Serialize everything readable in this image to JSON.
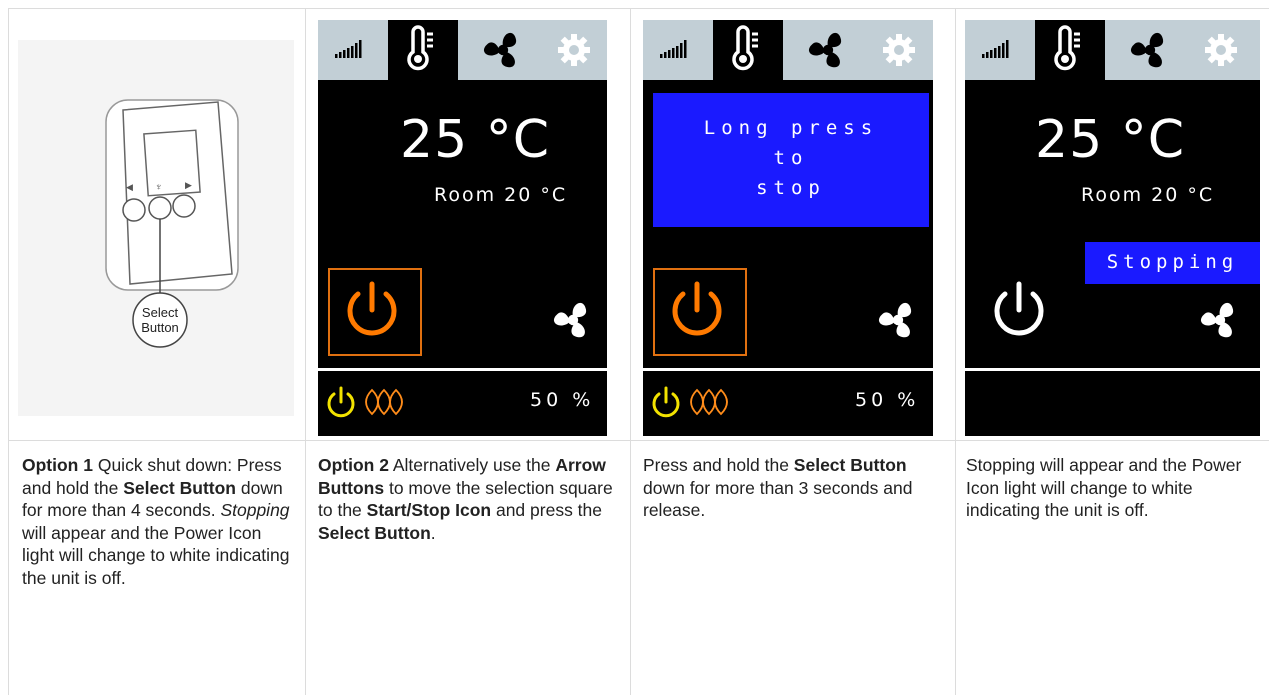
{
  "device": {
    "select_label_line1": "Select",
    "select_label_line2": "Button"
  },
  "screens": [
    {
      "temp": "25 °C",
      "room": "Room 20 °C",
      "percent": "50 %"
    },
    {
      "message_lines": [
        "Long press",
        "to",
        "stop"
      ],
      "percent": "50 %"
    },
    {
      "temp": "25 °C",
      "room": "Room 20 °C",
      "status": "Stopping"
    }
  ],
  "captions": [
    {
      "b1": "Option 1",
      "t1": " Quick shut down: Press and hold the ",
      "b2": "Select Button",
      "t2": " down for more than 4 seconds. ",
      "i1": "Stopping",
      "t3": " will appear and the Power Icon light will change to white indicating the unit is off."
    },
    {
      "b1": "Option 2",
      "t1": " Alternatively use the ",
      "b2": "Arrow Buttons",
      "t2": " to move the selection square to the ",
      "b3": "Start/Stop Icon",
      "t3": " and press the ",
      "b4": "Select Button",
      "t4": "."
    },
    {
      "t1": "Press and hold the ",
      "b1": "Select Button",
      "t2": " down for more than 3 seconds and release."
    },
    {
      "t1": "Stopping will appear and the Power Icon light will change to white indicating the unit is off."
    }
  ],
  "icons": [
    "signal-icon",
    "thermometer-icon",
    "fan-icon",
    "gear-icon",
    "power-icon",
    "heat-icon"
  ],
  "colors": {
    "accent_orange": "#ff7a00",
    "power_yellow": "#f2e200",
    "heat_orange": "#ff8c1a",
    "message_blue": "#1a1aff",
    "tabbar": "#c2cfd6"
  }
}
